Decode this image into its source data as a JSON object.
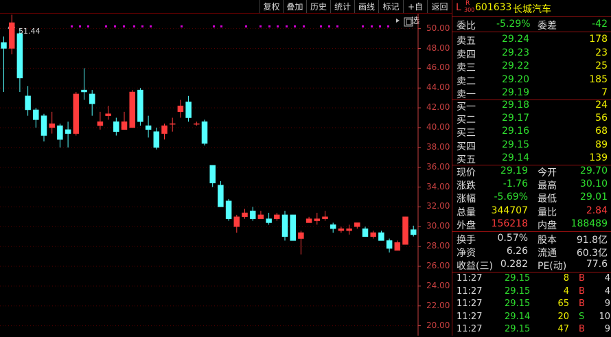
{
  "toolbar": {
    "buttons": [
      "复权",
      "叠加",
      "历史",
      "统计",
      "画线",
      "标记",
      "+自选",
      "返回"
    ]
  },
  "chart": {
    "peak_label": "51.44",
    "y_ticks": [
      "50.00",
      "48.00",
      "46.00",
      "44.00",
      "42.00",
      "40.00",
      "38.00",
      "36.00",
      "34.00",
      "32.00",
      "30.00",
      "28.00",
      "26.00",
      "24.00",
      "22.00",
      "20.00"
    ],
    "colors": {
      "up": "#ff3c3c",
      "down": "#54ffff",
      "grid": "#5a0000",
      "axis": "#c84040",
      "marker": "#d000d0"
    }
  },
  "chart_data": {
    "type": "candlestick",
    "ylim": [
      19.0,
      51.5
    ],
    "candles": [
      [
        48.6,
        48.0,
        49.2,
        43.6
      ],
      [
        48.0,
        50.6,
        51.4,
        47.4
      ],
      [
        49.5,
        45.0,
        50.0,
        43.6
      ],
      [
        43.2,
        41.8,
        44.2,
        41.2
      ],
      [
        41.8,
        40.8,
        42.0,
        40.0
      ],
      [
        41.2,
        39.2,
        41.4,
        38.6
      ],
      [
        40.0,
        40.4,
        41.6,
        39.4
      ],
      [
        40.2,
        38.8,
        40.4,
        38.0
      ],
      [
        39.8,
        39.4,
        40.6,
        38.0
      ],
      [
        39.4,
        43.4,
        43.6,
        39.2
      ],
      [
        43.8,
        43.6,
        46.0,
        42.8
      ],
      [
        43.4,
        42.4,
        43.8,
        41.2
      ],
      [
        40.2,
        40.6,
        41.6,
        39.8
      ],
      [
        41.2,
        41.4,
        42.2,
        40.8
      ],
      [
        40.6,
        39.6,
        41.0,
        39.2
      ],
      [
        39.8,
        40.6,
        41.6,
        39.8
      ],
      [
        40.0,
        43.6,
        43.8,
        40.0
      ],
      [
        43.8,
        40.6,
        44.0,
        40.2
      ],
      [
        40.2,
        39.8,
        41.2,
        39.0
      ],
      [
        39.6,
        38.0,
        40.0,
        37.8
      ],
      [
        39.4,
        40.2,
        40.4,
        38.8
      ],
      [
        40.4,
        40.4,
        41.0,
        39.6
      ],
      [
        41.6,
        42.2,
        42.8,
        41.0
      ],
      [
        42.6,
        41.0,
        43.2,
        40.6
      ],
      [
        40.4,
        40.4,
        40.6,
        40.2
      ],
      [
        40.6,
        38.4,
        40.8,
        38.2
      ],
      [
        36.2,
        34.4,
        36.2,
        34.0
      ],
      [
        34.2,
        32.0,
        34.6,
        32.0
      ],
      [
        32.6,
        30.8,
        32.8,
        30.6
      ],
      [
        30.0,
        31.0,
        31.2,
        29.4
      ],
      [
        31.0,
        31.4,
        31.8,
        30.8
      ],
      [
        31.6,
        30.8,
        32.0,
        30.6
      ],
      [
        30.8,
        31.2,
        31.6,
        30.8
      ],
      [
        30.8,
        30.4,
        31.4,
        30.2
      ],
      [
        30.8,
        31.2,
        31.4,
        30.6
      ],
      [
        31.2,
        29.0,
        31.6,
        28.6
      ],
      [
        31.2,
        28.6,
        31.2,
        28.6
      ],
      [
        28.8,
        29.4,
        29.6,
        27.2
      ],
      [
        30.4,
        30.8,
        31.0,
        30.4
      ],
      [
        30.6,
        30.8,
        31.4,
        30.2
      ],
      [
        30.8,
        31.0,
        31.6,
        30.6
      ],
      [
        30.2,
        29.8,
        30.4,
        29.4
      ],
      [
        29.6,
        29.8,
        30.0,
        29.4
      ],
      [
        29.6,
        29.8,
        30.2,
        29.2
      ],
      [
        30.0,
        30.4,
        30.4,
        29.8
      ],
      [
        29.8,
        29.0,
        30.0,
        29.0
      ],
      [
        29.0,
        29.4,
        29.6,
        28.8
      ],
      [
        29.4,
        28.6,
        29.6,
        28.6
      ],
      [
        28.6,
        27.8,
        28.8,
        27.4
      ],
      [
        27.6,
        28.4,
        28.6,
        27.6
      ],
      [
        28.2,
        31.0,
        31.0,
        28.2
      ],
      [
        29.7,
        29.19,
        30.1,
        29.01
      ]
    ],
    "peak_label": "51.44"
  },
  "panel": {
    "market_tag": "L",
    "r_tag": "R",
    "index_tag": "300",
    "code": "601633",
    "name": "长城汽车",
    "weibi_label": "委比",
    "weibi_value": "-5.29%",
    "weicha_label": "委差",
    "weicha_value": "-42",
    "asks": [
      {
        "label": "卖五",
        "price": "29.24",
        "vol": "178"
      },
      {
        "label": "卖四",
        "price": "29.23",
        "vol": "23"
      },
      {
        "label": "卖三",
        "price": "29.22",
        "vol": "25"
      },
      {
        "label": "卖二",
        "price": "29.20",
        "vol": "185"
      },
      {
        "label": "卖一",
        "price": "29.19",
        "vol": "7"
      }
    ],
    "bids": [
      {
        "label": "买一",
        "price": "29.18",
        "vol": "24"
      },
      {
        "label": "买二",
        "price": "29.17",
        "vol": "56"
      },
      {
        "label": "买三",
        "price": "29.16",
        "vol": "68"
      },
      {
        "label": "买四",
        "price": "29.15",
        "vol": "89"
      },
      {
        "label": "买五",
        "price": "29.14",
        "vol": "139"
      }
    ],
    "quote": [
      {
        "l1": "现价",
        "v1": "29.19",
        "c1": "green",
        "l2": "今开",
        "v2": "29.70",
        "c2": "green"
      },
      {
        "l1": "涨跌",
        "v1": "-1.76",
        "c1": "green",
        "l2": "最高",
        "v2": "30.10",
        "c2": "green"
      },
      {
        "l1": "涨幅",
        "v1": "-5.69%",
        "c1": "green",
        "l2": "最低",
        "v2": "29.01",
        "c2": "green"
      },
      {
        "l1": "总量",
        "v1": "344707",
        "c1": "yellow",
        "l2": "量比",
        "v2": "2.84",
        "c2": "red"
      },
      {
        "l1": "外盘",
        "v1": "156218",
        "c1": "red",
        "l2": "内盘",
        "v2": "188489",
        "c2": "green"
      }
    ],
    "fund": [
      {
        "l1": "换手",
        "v1": "0.57%",
        "l2": "股本",
        "v2": "91.8亿"
      },
      {
        "l1": "净资",
        "v1": "6.26",
        "l2": "流通",
        "v2": "60.3亿"
      },
      {
        "l1": "收益(三)",
        "v1": "0.282",
        "l2": "PE(动)",
        "v2": "77.6"
      }
    ],
    "ticks": [
      {
        "time": "11:27",
        "price": "29.15",
        "vol": "8",
        "side": "B",
        "n": "4"
      },
      {
        "time": "11:27",
        "price": "29.15",
        "vol": "4",
        "side": "B",
        "n": "4"
      },
      {
        "time": "11:27",
        "price": "29.15",
        "vol": "65",
        "side": "B",
        "n": "9"
      },
      {
        "time": "11:27",
        "price": "29.14",
        "vol": "20",
        "side": "S",
        "n": "10"
      },
      {
        "time": "11:27",
        "price": "29.15",
        "vol": "47",
        "side": "B",
        "n": "9"
      }
    ]
  }
}
